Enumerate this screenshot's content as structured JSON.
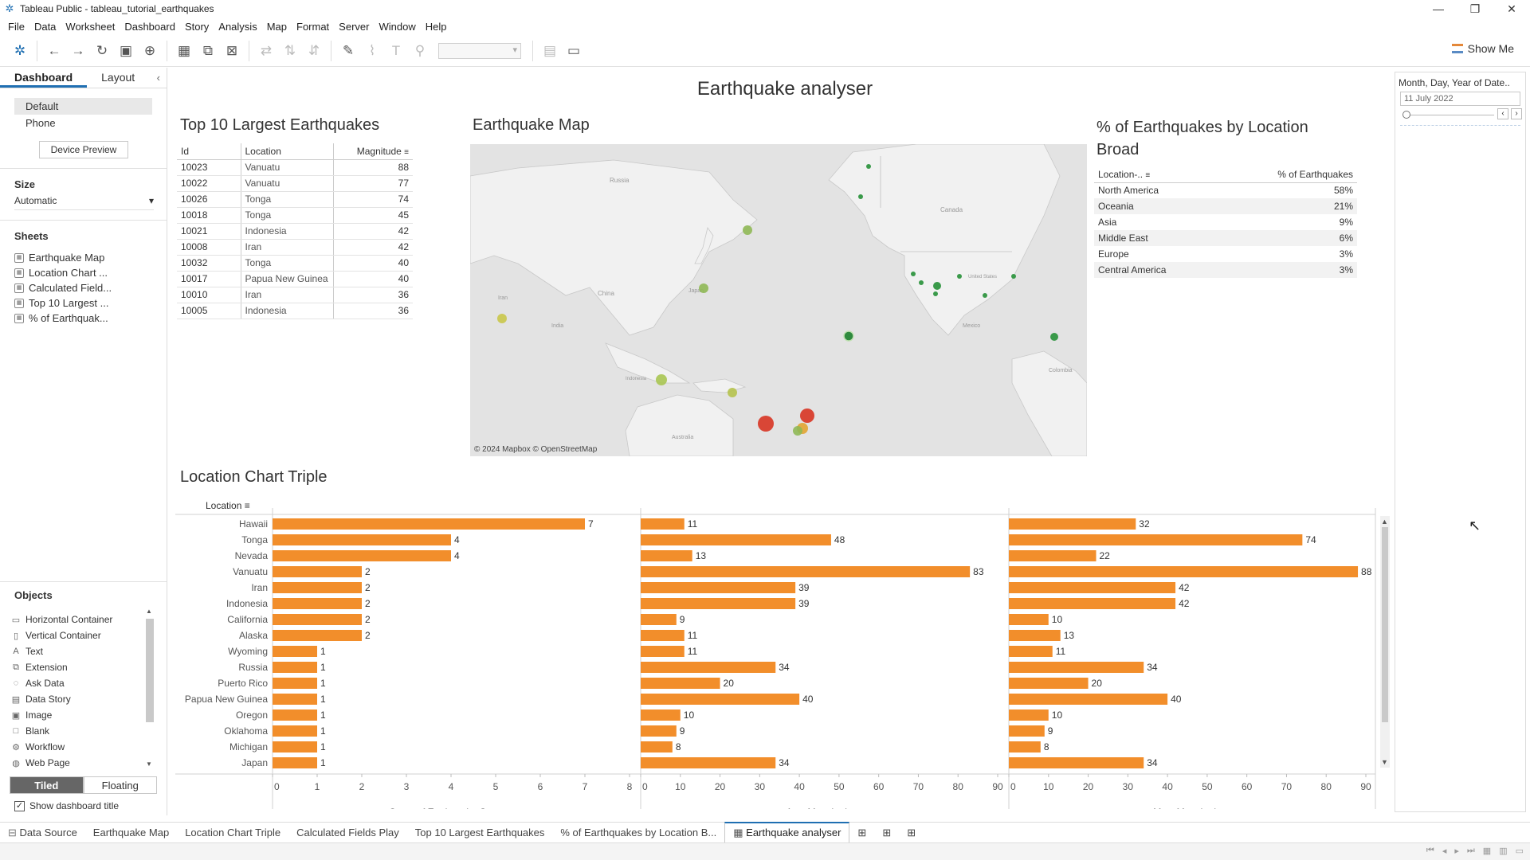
{
  "window": {
    "title": "Tableau Public - tableau_tutorial_earthquakes",
    "minimize": "—",
    "restore": "❐",
    "close": "✕"
  },
  "menu": [
    "File",
    "Data",
    "Worksheet",
    "Dashboard",
    "Story",
    "Analysis",
    "Map",
    "Format",
    "Server",
    "Window",
    "Help"
  ],
  "toolbar": {
    "show_me": "Show Me"
  },
  "left_panel": {
    "tabs": [
      "Dashboard",
      "Layout"
    ],
    "devices": [
      "Default",
      "Phone"
    ],
    "device_preview": "Device Preview",
    "size_heading": "Size",
    "size_value": "Automatic",
    "sheets_heading": "Sheets",
    "sheets": [
      "Earthquake Map",
      "Location Chart ...",
      "Calculated Field...",
      "Top 10 Largest ...",
      "% of Earthquak..."
    ],
    "objects_heading": "Objects",
    "objects": [
      {
        "label": "Horizontal Container",
        "icon": "horizontal-container-icon"
      },
      {
        "label": "Vertical Container",
        "icon": "vertical-container-icon"
      },
      {
        "label": "Text",
        "icon": "text-icon"
      },
      {
        "label": "Extension",
        "icon": "extension-icon"
      },
      {
        "label": "Ask Data",
        "icon": "ask-data-icon"
      },
      {
        "label": "Data Story",
        "icon": "data-story-icon"
      },
      {
        "label": "Image",
        "icon": "image-icon"
      },
      {
        "label": "Blank",
        "icon": "blank-icon"
      },
      {
        "label": "Workflow",
        "icon": "workflow-icon"
      },
      {
        "label": "Web Page",
        "icon": "web-page-icon"
      }
    ],
    "tiled": "Tiled",
    "floating": "Floating",
    "show_title": "Show dashboard title"
  },
  "dashboard": {
    "title": "Earthquake analyser",
    "top10": {
      "title": "Top 10 Largest Earthquakes",
      "headers": [
        "Id",
        "Location",
        "Magnitude"
      ],
      "rows": [
        [
          "10023",
          "Vanuatu",
          "88"
        ],
        [
          "10022",
          "Vanuatu",
          "77"
        ],
        [
          "10026",
          "Tonga",
          "74"
        ],
        [
          "10018",
          "Tonga",
          "45"
        ],
        [
          "10021",
          "Indonesia",
          "42"
        ],
        [
          "10008",
          "Iran",
          "42"
        ],
        [
          "10032",
          "Tonga",
          "40"
        ],
        [
          "10017",
          "Papua New Guinea",
          "40"
        ],
        [
          "10010",
          "Iran",
          "36"
        ],
        [
          "10005",
          "Indonesia",
          "36"
        ]
      ]
    },
    "map": {
      "title": "Earthquake Map",
      "attribution": "© 2024 Mapbox © OpenStreetMap",
      "labels": [
        "Russia",
        "Canada",
        "China",
        "Japan",
        "Iran",
        "India",
        "United States",
        "Mexico",
        "Colombia",
        "Indonesia",
        "Australia"
      ]
    },
    "pct": {
      "title_line1": "% of Earthquakes by Location",
      "title_line2": "Broad",
      "headers": [
        "Location-..",
        "% of Earthquakes"
      ],
      "rows": [
        [
          "North America",
          "58%"
        ],
        [
          "Oceania",
          "21%"
        ],
        [
          "Asia",
          "9%"
        ],
        [
          "Middle East",
          "6%"
        ],
        [
          "Europe",
          "3%"
        ],
        [
          "Central America",
          "3%"
        ]
      ]
    },
    "filter": {
      "title": "Month, Day, Year of Date..",
      "value": "11 July 2022"
    }
  },
  "chart_data": {
    "type": "bar",
    "title": "Location Chart Triple",
    "row_header": "Location",
    "categories": [
      "Hawaii",
      "Tonga",
      "Nevada",
      "Vanuatu",
      "Iran",
      "Indonesia",
      "California",
      "Alaska",
      "Wyoming",
      "Russia",
      "Puerto Rico",
      "Papua New Guinea",
      "Oregon",
      "Oklahoma",
      "Michigan",
      "Japan"
    ],
    "series": [
      {
        "name": "Count of Earthquake Counter",
        "values": [
          7,
          4,
          4,
          2,
          2,
          2,
          2,
          2,
          1,
          1,
          1,
          1,
          1,
          1,
          1,
          1
        ],
        "axis_max": 8,
        "ticks": [
          0,
          1,
          2,
          3,
          4,
          5,
          6,
          7,
          8
        ]
      },
      {
        "name": "Avg. Magnitude",
        "values": [
          11,
          48,
          13,
          83,
          39,
          39,
          9,
          11,
          11,
          34,
          20,
          40,
          10,
          9,
          8,
          34
        ],
        "axis_max": 90,
        "ticks": [
          0,
          10,
          20,
          30,
          40,
          50,
          60,
          70,
          80,
          90
        ]
      },
      {
        "name": "Max. Magnitude",
        "values": [
          32,
          74,
          22,
          88,
          42,
          42,
          10,
          13,
          11,
          34,
          20,
          40,
          10,
          9,
          8,
          34
        ],
        "axis_max": 90,
        "ticks": [
          0,
          10,
          20,
          30,
          40,
          50,
          60,
          70,
          80,
          90
        ]
      }
    ],
    "bar_color": "#f28e2b"
  },
  "bottom_tabs": {
    "data_source": "Data Source",
    "sheets": [
      "Earthquake Map",
      "Location Chart Triple",
      "Calculated Fields Play",
      "Top 10 Largest Earthquakes",
      "% of Earthquakes by Location B..."
    ],
    "active": "Earthquake analyser"
  }
}
